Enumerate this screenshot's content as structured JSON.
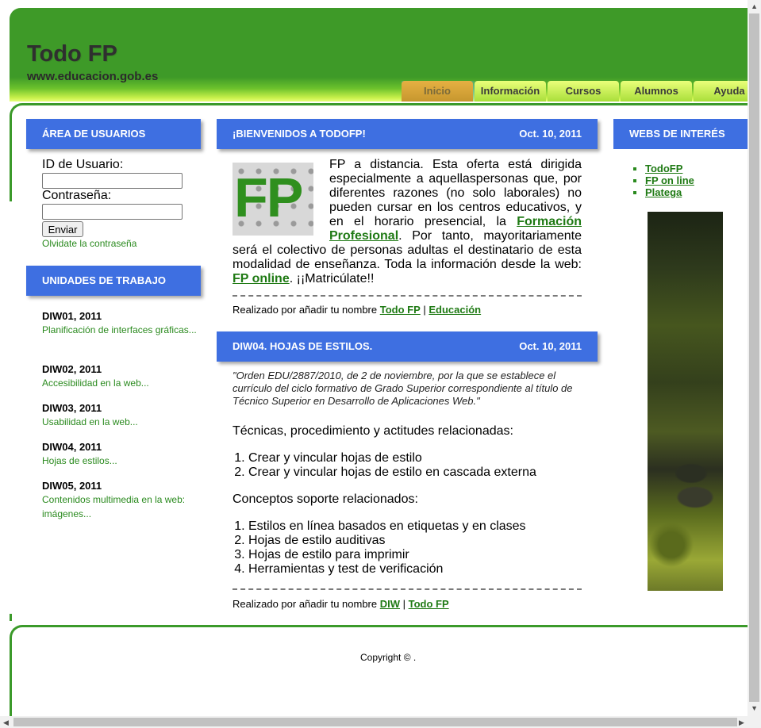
{
  "header": {
    "site_title": "Todo FP",
    "site_url": "www.educacion.gob.es",
    "nav": [
      "Inicio",
      "Información",
      "Cursos",
      "Alumnos",
      "Ayuda"
    ],
    "active_tab": "Inicio"
  },
  "login": {
    "title": "ÁREA DE USUARIOS",
    "user_label": "ID de Usuario:",
    "user_value": "",
    "password_label": "Contraseña:",
    "password_value": "",
    "submit_label": "Enviar",
    "forgot_label": "Olvidate la contraseña"
  },
  "units": {
    "title": "UNIDADES DE TRABAJO",
    "items": [
      {
        "title": "DIW01, 2011",
        "desc": "Planificación de interfaces gráficas..."
      },
      {
        "title": "DIW02, 2011",
        "desc": "Accesibilidad en la web..."
      },
      {
        "title": "DIW03, 2011",
        "desc": "Usabilidad en la web..."
      },
      {
        "title": "DIW04, 2011",
        "desc": "Hojas de estilos..."
      },
      {
        "title": "DIW05, 2011",
        "desc": "Contenidos multimedia en la web: imágenes..."
      }
    ]
  },
  "article1": {
    "title": "¡BIENVENIDOS A TODOFP!",
    "date": "Oct. 10, 2011",
    "logo_text": "FP",
    "text_1": "FP a distancia. Esta oferta está dirigida especialmente a aquellaspersonas que, por diferentes razones (no solo laborales) no pueden cursar en los centros educativos, y en el horario presencial, la ",
    "link_1": "Formación Profesional",
    "text_2": ". Por tanto, mayoritariamente será el colectivo de personas adultas el destinatario de esta modalidad de enseñanza. Toda la información desde la web: ",
    "link_2": "FP online",
    "text_3": ". ¡¡Matricúlate!!",
    "footer_text": "Realizado por añadir tu nombre ",
    "footer_link1": "Todo FP",
    "footer_sep": " | ",
    "footer_link2": "Educación"
  },
  "article2": {
    "title": "DIW04. HOJAS DE ESTILOS.",
    "date": "Oct. 10, 2011",
    "quote": "\"Orden EDU/2887/2010, de 2 de noviembre, por la que se establece el currículo del ciclo formativo de Grado Superior correspondiente al título de Técnico Superior en Desarrollo de Aplicaciones Web.\"",
    "section1": "Técnicas, procedimiento y actitudes relacionadas:",
    "list1": [
      "Crear y vincular hojas de estilo",
      "Crear y vincular hojas de estilo en cascada externa"
    ],
    "section2": "Conceptos soporte relacionados:",
    "list2": [
      "Estilos en línea basados en etiquetas y en clases",
      "Hojas de estilo auditivas",
      "Hojas de estilo para imprimir",
      "Herramientas y test de verificación"
    ],
    "footer_text": "Realizado por añadir tu nombre ",
    "footer_link1": "DIW",
    "footer_sep": " | ",
    "footer_link2": "Todo FP"
  },
  "sidebar_right": {
    "title": "WEBS DE INTERÉS",
    "links": [
      "TodoFP",
      "FP on line",
      "Platega"
    ]
  },
  "footer": {
    "copyright": "Copyright © ."
  },
  "colors": {
    "header_green": "#3e9a28",
    "box_blue": "#3e6fe1",
    "link_green": "#1f7a14"
  }
}
